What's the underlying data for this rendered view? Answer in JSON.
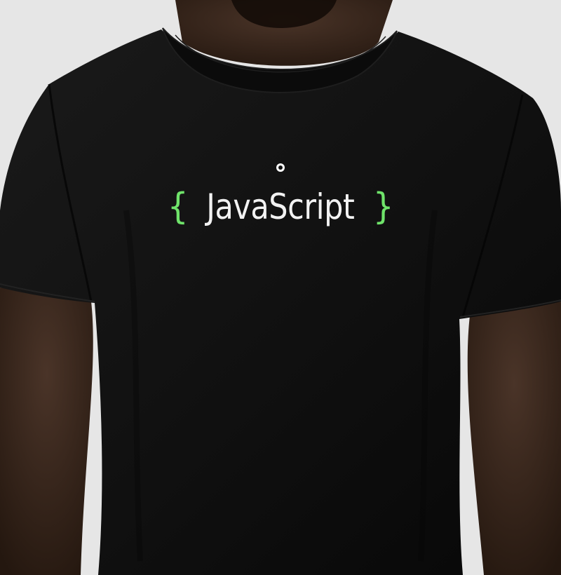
{
  "image": {
    "description_free": true,
    "colors": {
      "background": "#e6e6e6",
      "skin": "#3a2a22",
      "skin_shadow": "#24180f",
      "shirt": "#111111",
      "shirt_shadow": "#080808",
      "text": "#f2f2f2",
      "accent": "#6fe36a"
    }
  },
  "print": {
    "left_brace": "{",
    "word": "JavaScript",
    "right_brace": "}",
    "logo_icon": "small-round-logo-icon"
  }
}
